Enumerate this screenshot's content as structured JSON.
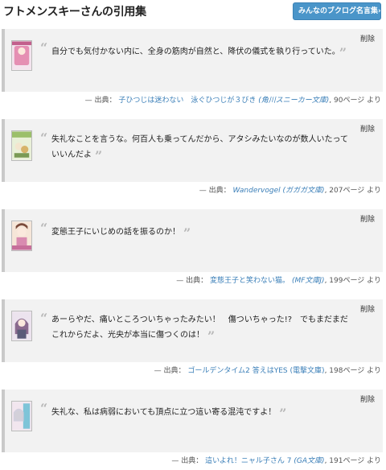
{
  "page": {
    "title": "フトメンスキーさんの引用集",
    "all_button_label": "みんなのブクログ名言集»"
  },
  "common": {
    "delete_label": "削除",
    "source_prefix": "— 出典：",
    "page_suffix": "ページ より",
    "open_quote": "“",
    "close_quote": "”"
  },
  "quotes": [
    {
      "text": "自分でも気付かない内に、全身の筋肉が自然と、降伏の儀式を執り行っていた。",
      "book": "子ひつじは迷わない　泳ぐひつじが３びき",
      "label": "(角川スニーカー文庫)",
      "page": "90",
      "cover_colors": [
        "#e58fb3",
        "#f4e4ee"
      ]
    },
    {
      "text": "失礼なことを言うな。何百人も乗ってんだから、アタシみたいなのが数人いたっていいんだよ",
      "book": "Wandervogel",
      "label": "(ガガガ文庫)",
      "page": "207",
      "cover_colors": [
        "#9bbf6a",
        "#e9f0d8"
      ]
    },
    {
      "text": "変態王子にいじめの話を振るのか！",
      "book": "変態王子と笑わない猫。",
      "label": "(MF文庫J)",
      "page": "199",
      "cover_colors": [
        "#d98bb0",
        "#f6e6d8"
      ]
    },
    {
      "text": "あーらやだ、痛いところついちゃったみたい！　傷ついちゃった!?　でもまだまだこれからだよ、光央が本当に傷つくのは！",
      "book": "ゴールデンタイム2 答えはYES",
      "label": "(電撃文庫)",
      "page": "198",
      "cover_colors": [
        "#8a6a8e",
        "#ece3ee"
      ]
    },
    {
      "text": "失礼な、私は病弱においても頂点に立つ這い寄る混沌ですよ！",
      "book": "這いよれ！ニャル子さん 7",
      "label": "(GA文庫)",
      "page": "191",
      "cover_colors": [
        "#7ec4d8",
        "#f2e6ef"
      ]
    }
  ]
}
